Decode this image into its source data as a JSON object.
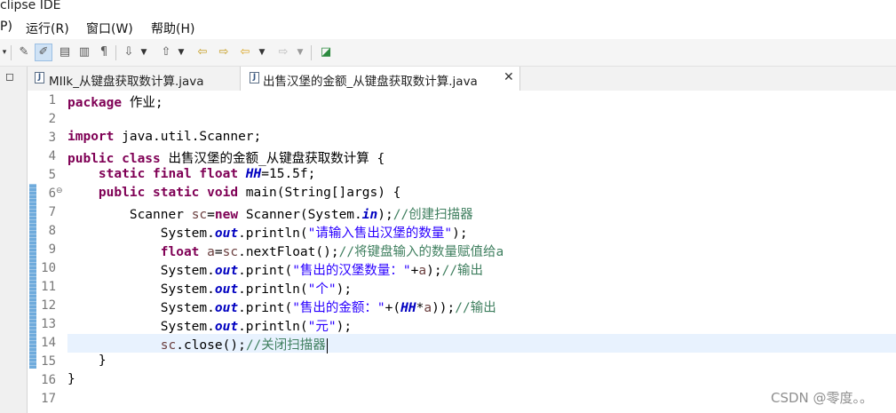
{
  "window": {
    "title": "clipse IDE"
  },
  "menu": [
    {
      "label": "P)"
    },
    {
      "label": "运行(R)"
    },
    {
      "label": "窗口(W)"
    },
    {
      "label": "帮助(H)"
    }
  ],
  "toolbar": {
    "icons": [
      "toggle-mark-occurrences-icon",
      "toggle-breadcrumb-icon",
      "highlight-edit-icon",
      "block-selection-icon",
      "word-wrap-icon",
      "show-whitespace-icon",
      "next-annotation-icon",
      "previous-annotation-icon",
      "last-edit-icon",
      "back-icon",
      "forward-icon",
      "pin-editor-icon"
    ]
  },
  "left_panel": {
    "icon": "minimize-icon"
  },
  "tabs": [
    {
      "label": "MIlk_从键盘获取数计算.java",
      "active": false
    },
    {
      "label": "出售汉堡的金额_从键盘获取数计算.java",
      "active": true
    }
  ],
  "editor": {
    "line_numbers": [
      "1",
      "2",
      "3",
      "4",
      "5",
      "6",
      "7",
      "8",
      "9",
      "10",
      "11",
      "12",
      "13",
      "14",
      "15",
      "16",
      "17"
    ],
    "lines": {
      "l1": {
        "kw": "package",
        "rest": " 作业;"
      },
      "l3": {
        "kw": "import",
        "rest": " java.util.Scanner;"
      },
      "l4": {
        "kw": "public class",
        "rest": " 出售汉堡的金额_从键盘获取数计算 {"
      },
      "l5": {
        "indent": "    ",
        "kw": "static final float",
        "sp": " ",
        "field": "HH",
        "rest": "=15.5f;"
      },
      "l6": {
        "indent": "    ",
        "kw": "public static void",
        "rest": " main(String[]args) {"
      },
      "l7": {
        "indent": "        ",
        "a": "Scanner ",
        "var": "sc",
        "b": "=",
        "kw": "new",
        "c": " Scanner(System.",
        "field": "in",
        "d": ");",
        "comment": "//创建扫描器"
      },
      "l8": {
        "indent": "            ",
        "a": "System.",
        "field": "out",
        "b": ".println(",
        "str": "\"请输入售出汉堡的数量\"",
        "c": ");"
      },
      "l9": {
        "indent": "            ",
        "kw": "float",
        "sp": " ",
        "var": "a",
        "b": "=",
        "var2": "sc",
        "c": ".nextFloat();",
        "comment": "//将键盘输入的数量赋值给a"
      },
      "l10": {
        "indent": "            ",
        "a": "System.",
        "field": "out",
        "b": ".print(",
        "str": "\"售出的汉堡数量：\"",
        "c": "+",
        "var": "a",
        "d": ");",
        "comment": "//输出"
      },
      "l11": {
        "indent": "            ",
        "a": "System.",
        "field": "out",
        "b": ".println(",
        "str": "\"个\"",
        "c": ");"
      },
      "l12": {
        "indent": "            ",
        "a": "System.",
        "field": "out",
        "b": ".print(",
        "str": "\"售出的金额：\"",
        "c": "+(",
        "field2": "HH",
        "d": "*",
        "var": "a",
        "e": "));",
        "comment": "//输出"
      },
      "l13": {
        "indent": "            ",
        "a": "System.",
        "field": "out",
        "b": ".println(",
        "str": "\"元\"",
        "c": ");"
      },
      "l14": {
        "indent": "            ",
        "var": "sc",
        "a": ".close();",
        "comment": "//关闭扫描器"
      },
      "l15": {
        "text": "    }"
      },
      "l16": {
        "text": "}"
      }
    }
  },
  "watermark": "CSDN @零度。。"
}
